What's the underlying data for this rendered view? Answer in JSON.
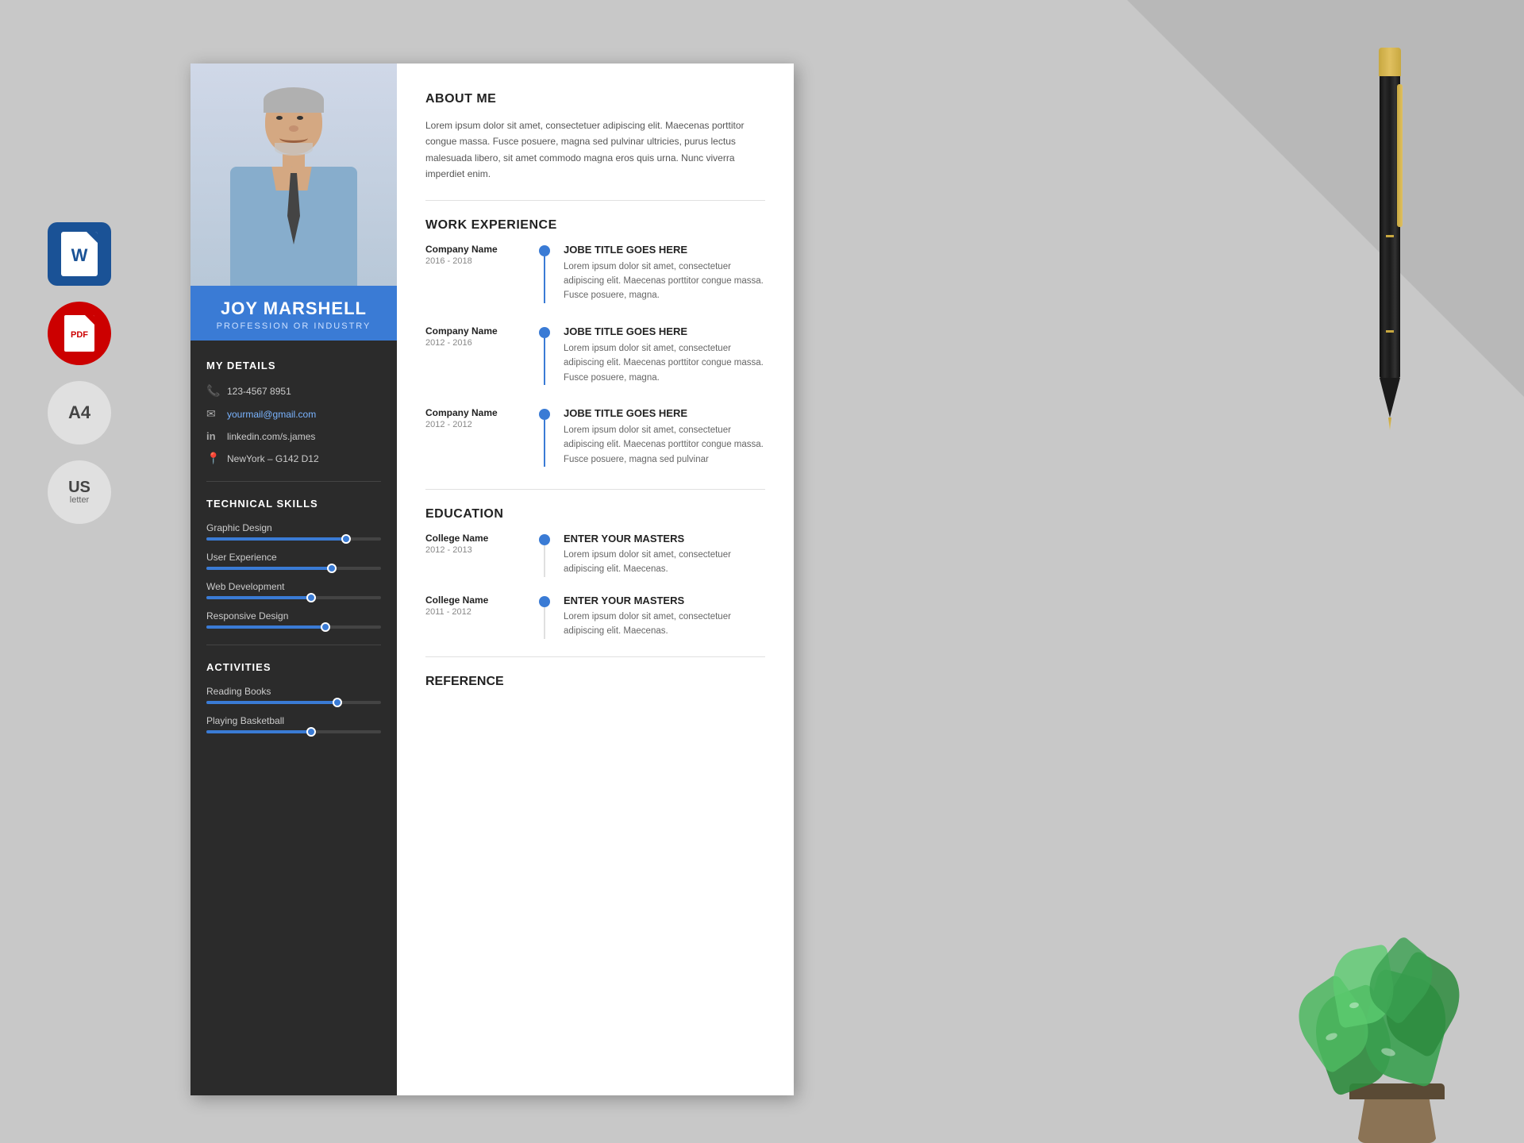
{
  "page": {
    "background_color": "#c8c8c8"
  },
  "left_icons": {
    "word_label": "W",
    "pdf_label": "PDF",
    "a4_label": "A4",
    "us_label": "US",
    "us_sublabel": "letter"
  },
  "resume": {
    "person_name": "JOY MARSHELL",
    "person_title": "PROFESSION OR INDUSTRY",
    "about_title": "ABOUT ME",
    "about_text": "Lorem ipsum dolor sit amet, consectetuer adipiscing elit. Maecenas porttitor congue massa. Fusce posuere, magna sed pulvinar ultricies, purus lectus malesuada libero, sit amet commodo magna eros quis urna. Nunc viverra imperdiet enim.",
    "details_title": "MY DETAILS",
    "phone": "123-4567 8951",
    "email": "yourmail@gmail.com",
    "linkedin": "linkedin.com/s.james",
    "address": "NewYork – G142 D12",
    "skills_title": "TECHNICAL SKILLS",
    "skills": [
      {
        "name": "Graphic Design",
        "percent": 80
      },
      {
        "name": "User Experience",
        "percent": 72
      },
      {
        "name": "Web Development",
        "percent": 60
      },
      {
        "name": "Responsive Design",
        "percent": 68
      }
    ],
    "activities_title": "ACTIVITIES",
    "activities": [
      {
        "name": "Reading Books",
        "percent": 75
      },
      {
        "name": "Playing Basketball",
        "percent": 60
      }
    ],
    "work_title": "WORK EXPERIENCE",
    "work_items": [
      {
        "company": "Company Name",
        "dates": "2016 - 2018",
        "job_title": "JOBE TITLE GOES HERE",
        "description": "Lorem ipsum dolor sit amet, consectetuer adipiscing elit. Maecenas porttitor congue massa. Fusce posuere, magna."
      },
      {
        "company": "Company Name",
        "dates": "2012 - 2016",
        "job_title": "JOBE TITLE GOES HERE",
        "description": "Lorem ipsum dolor sit amet, consectetuer adipiscing elit. Maecenas porttitor congue massa. Fusce posuere, magna."
      },
      {
        "company": "Company Name",
        "dates": "2012 - 2012",
        "job_title": "JOBE TITLE GOES HERE",
        "description": "Lorem ipsum dolor sit amet, consectetuer adipiscing elit. Maecenas porttitor congue massa. Fusce posuere, magna sed pulvinar"
      }
    ],
    "education_title": "EDUCATION",
    "education_items": [
      {
        "college": "College Name",
        "dates": "2012 - 2013",
        "degree": "ENTER YOUR MASTERS",
        "description": "Lorem ipsum dolor sit amet, consectetuer adipiscing elit. Maecenas."
      },
      {
        "college": "College Name",
        "dates": "2011 - 2012",
        "degree": "ENTER YOUR MASTERS",
        "description": "Lorem ipsum dolor sit amet, consectetuer adipiscing elit. Maecenas."
      }
    ],
    "reference_title": "REFERENCE"
  }
}
